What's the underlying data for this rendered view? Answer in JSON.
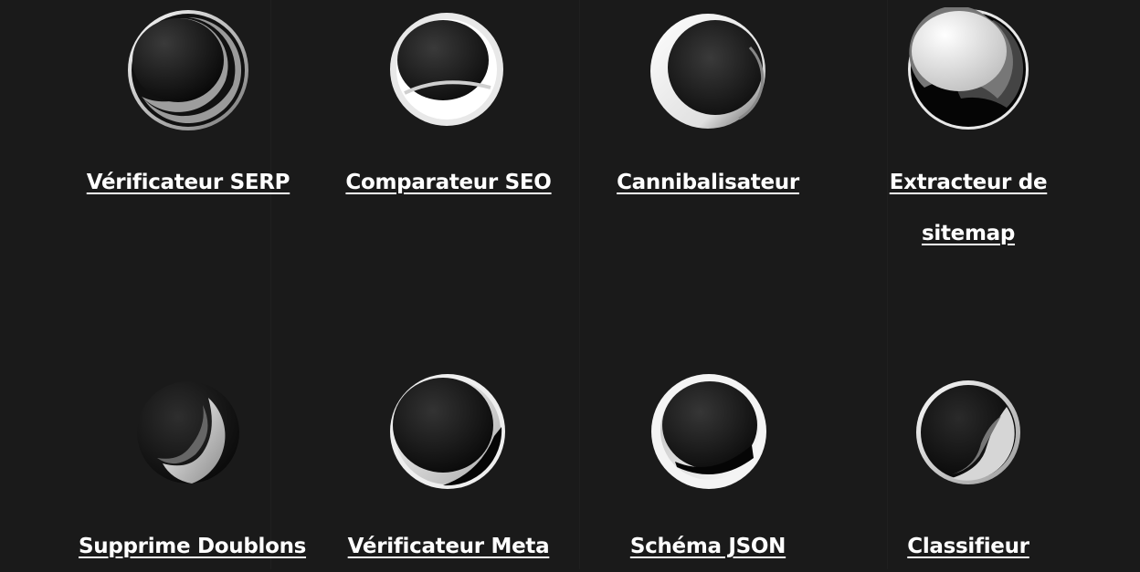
{
  "tools": [
    {
      "label": "Vérificateur SERP",
      "icon": "crescent-sphere-icon"
    },
    {
      "label": "Comparateur SEO",
      "icon": "ringed-sphere-icon"
    },
    {
      "label": "Cannibalisateur",
      "icon": "eclipse-sphere-icon"
    },
    {
      "label": "Extracteur de sitemap",
      "icon": "moon-sphere-icon"
    },
    {
      "label": "Supprime Doublons",
      "icon": "wave-sphere-icon"
    },
    {
      "label": "Vérificateur Meta",
      "icon": "glossy-sphere-icon"
    },
    {
      "label": "Schéma JSON",
      "icon": "ring-sphere-icon"
    },
    {
      "label": "Classifieur",
      "icon": "swirl-sphere-icon"
    }
  ]
}
